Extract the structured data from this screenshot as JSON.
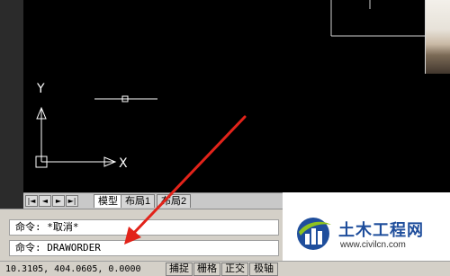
{
  "layout_tabs": [
    {
      "label": "模型",
      "active": true
    },
    {
      "label": "布局1",
      "active": false
    },
    {
      "label": "布局2",
      "active": false
    }
  ],
  "tab_nav": {
    "first": "|◄",
    "prev": "◄",
    "next": "►",
    "last": "►|"
  },
  "ucs": {
    "x_label": "X",
    "y_label": "Y"
  },
  "command_window": {
    "lines": [
      "命令: *取消*",
      "命令: DRAWORDER"
    ]
  },
  "status_bar": {
    "coordinates": "10.3105,  404.0605, 0.0000",
    "buttons": [
      "捕捉",
      "栅格",
      "正交",
      "极轴"
    ]
  },
  "watermark": {
    "title": "土木工程网",
    "url": "www.civilcn.com"
  },
  "colors": {
    "canvas_bg": "#000000",
    "ui_gray": "#d4d0c8",
    "arrow_red": "#e2231a",
    "watermark_blue": "#1f4e9c"
  }
}
